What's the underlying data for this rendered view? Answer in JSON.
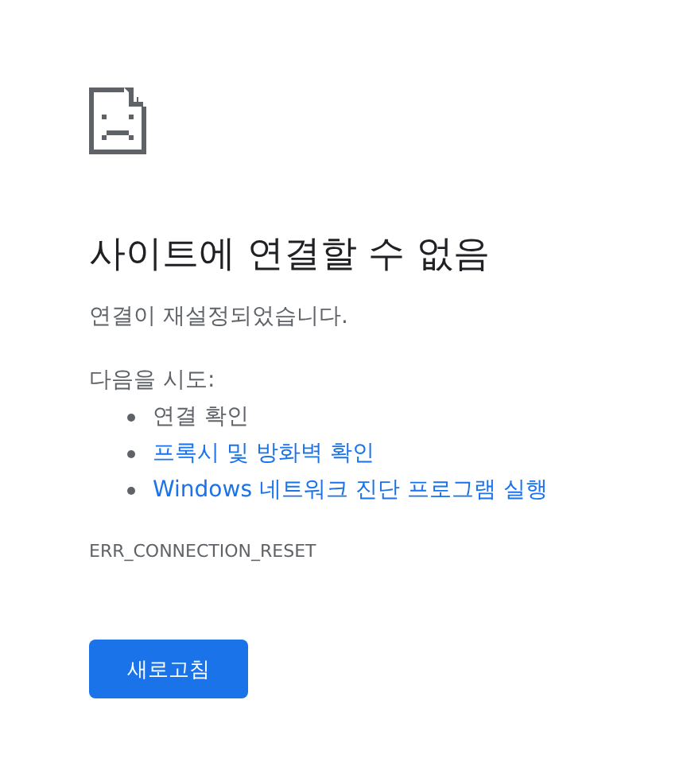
{
  "heading": "사이트에 연결할 수 없음",
  "summary": "연결이 재설정되었습니다.",
  "suggestions_label": "다음을 시도:",
  "suggestions": [
    {
      "kind": "text",
      "label": "연결 확인"
    },
    {
      "kind": "link",
      "label": "프록시 및 방화벽 확인"
    },
    {
      "kind": "link",
      "label": "Windows 네트워크 진단 프로그램 실행"
    }
  ],
  "error_code": "ERR_CONNECTION_RESET",
  "reload_button": "새로고침"
}
